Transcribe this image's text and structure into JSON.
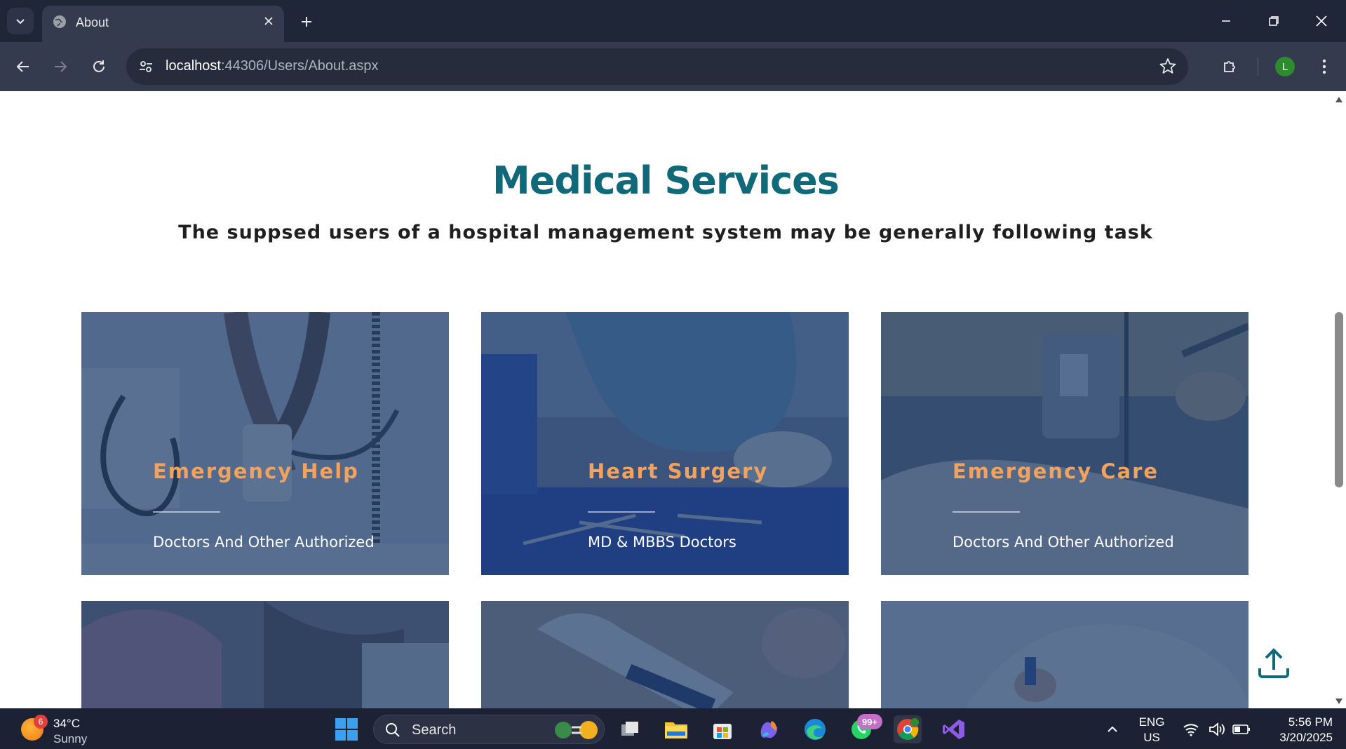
{
  "browser": {
    "tab_title": "About",
    "url_host": "localhost",
    "url_rest": ":44306/Users/About.aspx",
    "profile_initial": "L"
  },
  "page": {
    "heading": "Medical Services",
    "subheading": "The suppsed users of a hospital management system may be generally following task",
    "cards": [
      {
        "title": "Emergency Help",
        "subtitle": "Doctors And Other Authorized"
      },
      {
        "title": "Heart Surgery",
        "subtitle": "MD & MBBS Doctors"
      },
      {
        "title": "Emergency Care",
        "subtitle": "Doctors And Other Authorized"
      }
    ]
  },
  "taskbar": {
    "weather_temp": "34°C",
    "weather_desc": "Sunny",
    "weather_badge": "6",
    "search_label": "Search",
    "whatsapp_badge": "99+",
    "lang_top": "ENG",
    "lang_bottom": "US",
    "time": "5:56 PM",
    "date": "3/20/2025"
  },
  "colors": {
    "heading": "#0f6978",
    "card_title": "#f0a25e",
    "card_overlay": "#21406e",
    "chrome_bg": "#1f2638"
  }
}
